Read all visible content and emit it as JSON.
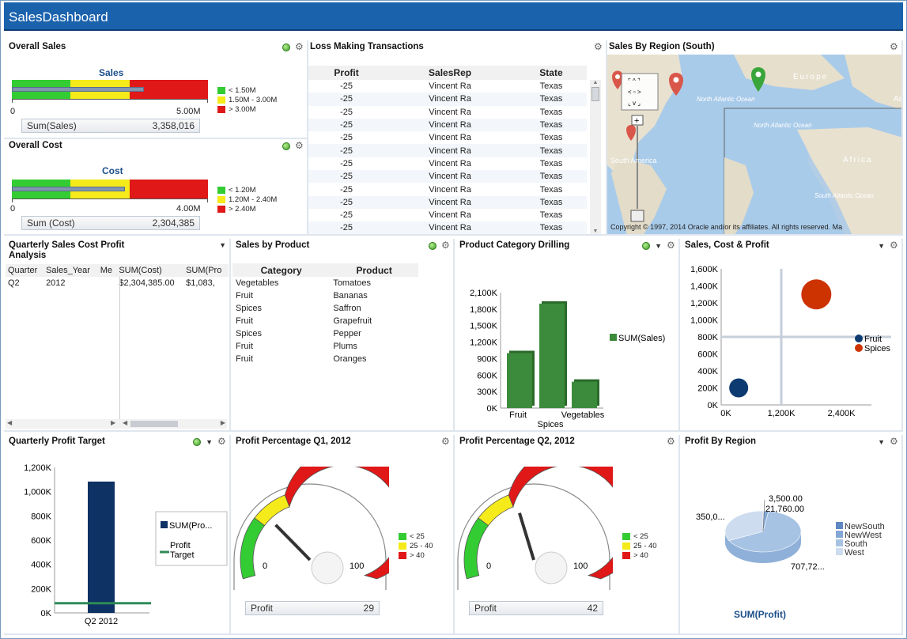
{
  "app": {
    "title": "SalesDashboard"
  },
  "overall_sales": {
    "title": "Overall Sales",
    "chart_title": "Sales",
    "axis_min": "0",
    "axis_max": "5.00M",
    "legend": [
      "< 1.50M",
      "1.50M - 3.00M",
      "> 3.00M"
    ],
    "sum_label": "Sum(Sales)",
    "sum_value": "3,358,016",
    "value_fraction": 0.6716
  },
  "overall_cost": {
    "title": "Overall Cost",
    "chart_title": "Cost",
    "axis_min": "0",
    "axis_max": "4.00M",
    "legend": [
      "< 1.20M",
      "1.20M - 2.40M",
      "> 2.40M"
    ],
    "sum_label": "Sum (Cost)",
    "sum_value": "2,304,385",
    "value_fraction": 0.576
  },
  "loss_making": {
    "title": "Loss Making Transactions",
    "columns": [
      "Profit",
      "SalesRep",
      "State"
    ],
    "rows": [
      [
        "-25",
        "Vincent Ra",
        "Texas"
      ],
      [
        "-25",
        "Vincent Ra",
        "Texas"
      ],
      [
        "-25",
        "Vincent Ra",
        "Texas"
      ],
      [
        "-25",
        "Vincent Ra",
        "Texas"
      ],
      [
        "-25",
        "Vincent Ra",
        "Texas"
      ],
      [
        "-25",
        "Vincent Ra",
        "Texas"
      ],
      [
        "-25",
        "Vincent Ra",
        "Texas"
      ],
      [
        "-25",
        "Vincent Ra",
        "Texas"
      ],
      [
        "-25",
        "Vincent Ra",
        "Texas"
      ],
      [
        "-25",
        "Vincent Ra",
        "Texas"
      ],
      [
        "-25",
        "Vincent Ra",
        "Texas"
      ],
      [
        "-25",
        "Vincent Ra",
        "Texas"
      ]
    ]
  },
  "sales_region": {
    "title": "Sales By Region (South)",
    "map_labels": [
      "Europe",
      "North Atlantic Ocean",
      "North Atlantic Ocean",
      "South America",
      "Africa",
      "South Atlantic Ocean",
      "As"
    ],
    "copyright": "Copyright © 1997, 2014 Oracle and/or its affiliates. All rights reserved. Ma"
  },
  "quarterly_sales": {
    "title": "Quarterly Sales Cost Profit Analysis",
    "columns": [
      "Quarter",
      "Sales_Year",
      "Me",
      "SUM(Cost)",
      "SUM(Pro"
    ],
    "rows": [
      [
        "Q2",
        "2012",
        "",
        "$2,304,385.00",
        "$1,083,"
      ]
    ]
  },
  "sales_product": {
    "title": "Sales by Product",
    "columns": [
      "Category",
      "Product"
    ],
    "rows": [
      [
        "Vegetables",
        "Tomatoes"
      ],
      [
        "Fruit",
        "Bananas"
      ],
      [
        "Spices",
        "Saffron"
      ],
      [
        "Fruit",
        "Grapefruit"
      ],
      [
        "Spices",
        "Pepper"
      ],
      [
        "Fruit",
        "Plums"
      ],
      [
        "Fruit",
        "Oranges"
      ]
    ]
  },
  "product_drill": {
    "title": "Product Category Drilling"
  },
  "sales_cost_profit": {
    "title": "Sales, Cost & Profit"
  },
  "profit_target": {
    "title": "Quarterly Profit Target"
  },
  "profit_q1": {
    "title": "Profit Percentage Q1, 2012",
    "legend": [
      "< 25",
      "25 - 40",
      "> 40"
    ],
    "min": "0",
    "max": "100",
    "label": "Profit",
    "value": "29"
  },
  "profit_q2": {
    "title": "Profit Percentage Q2, 2012",
    "legend": [
      "< 25",
      "25 - 40",
      "> 40"
    ],
    "min": "0",
    "max": "100",
    "label": "Profit",
    "value": "42"
  },
  "profit_region": {
    "title": "Profit By Region",
    "footer": "SUM(Profit)"
  },
  "chart_data": [
    {
      "type": "bar",
      "title": "",
      "categories": [
        "Fruit",
        "Spices",
        "Vegetables"
      ],
      "series": [
        {
          "name": "SUM(Sales)",
          "values": [
            1000000,
            1900000,
            480000
          ]
        }
      ],
      "ylim": [
        0,
        2100000
      ],
      "yticks": [
        "0K",
        "300K",
        "600K",
        "900K",
        "1,200K",
        "1,500K",
        "1,800K",
        "2,100K"
      ],
      "color": "#3c8b3c"
    },
    {
      "type": "scatter",
      "title": "",
      "series": [
        {
          "name": "Fruit",
          "points": [
            [
              350000,
              200000
            ]
          ],
          "color": "#0d3a70"
        },
        {
          "name": "Spices",
          "points": [
            [
              1900000,
              1300000
            ]
          ],
          "color": "#cc3300"
        }
      ],
      "xlim": [
        0,
        3000000
      ],
      "ylim": [
        0,
        1600000
      ],
      "xticks": [
        "0K",
        "1,200K",
        "2,400K"
      ],
      "yticks": [
        "0K",
        "200K",
        "400K",
        "600K",
        "800K",
        "1,000K",
        "1,200K",
        "1,400K",
        "1,600K"
      ]
    },
    {
      "type": "bar",
      "title": "",
      "categories": [
        "Q2 2012"
      ],
      "series": [
        {
          "name": "SUM(Pro...",
          "values": [
            1083000
          ],
          "color": "#0d3263"
        },
        {
          "name": "Profit Target",
          "values": [
            80000
          ],
          "color": "#2e8b57"
        }
      ],
      "ylim": [
        0,
        1200000
      ],
      "yticks": [
        "0K",
        "200K",
        "400K",
        "600K",
        "800K",
        "1,000K",
        "1,200K"
      ]
    },
    {
      "type": "pie",
      "title": "",
      "slices": [
        {
          "name": "NewSouth",
          "value": 3500,
          "label": "3,500.00",
          "color": "#5f87c2"
        },
        {
          "name": "NewWest",
          "value": 21760,
          "label": "21,760.00",
          "color": "#84a7d6"
        },
        {
          "name": "South",
          "value": 707720,
          "label": "707,72...",
          "color": "#a7c3e4"
        },
        {
          "name": "West",
          "value": 350000,
          "label": "350,0...",
          "color": "#cddcef"
        }
      ]
    }
  ],
  "colors": {
    "header": "#1b62ad",
    "green": "#33cc33",
    "yellow": "#f5ea1a",
    "red": "#e01818"
  }
}
